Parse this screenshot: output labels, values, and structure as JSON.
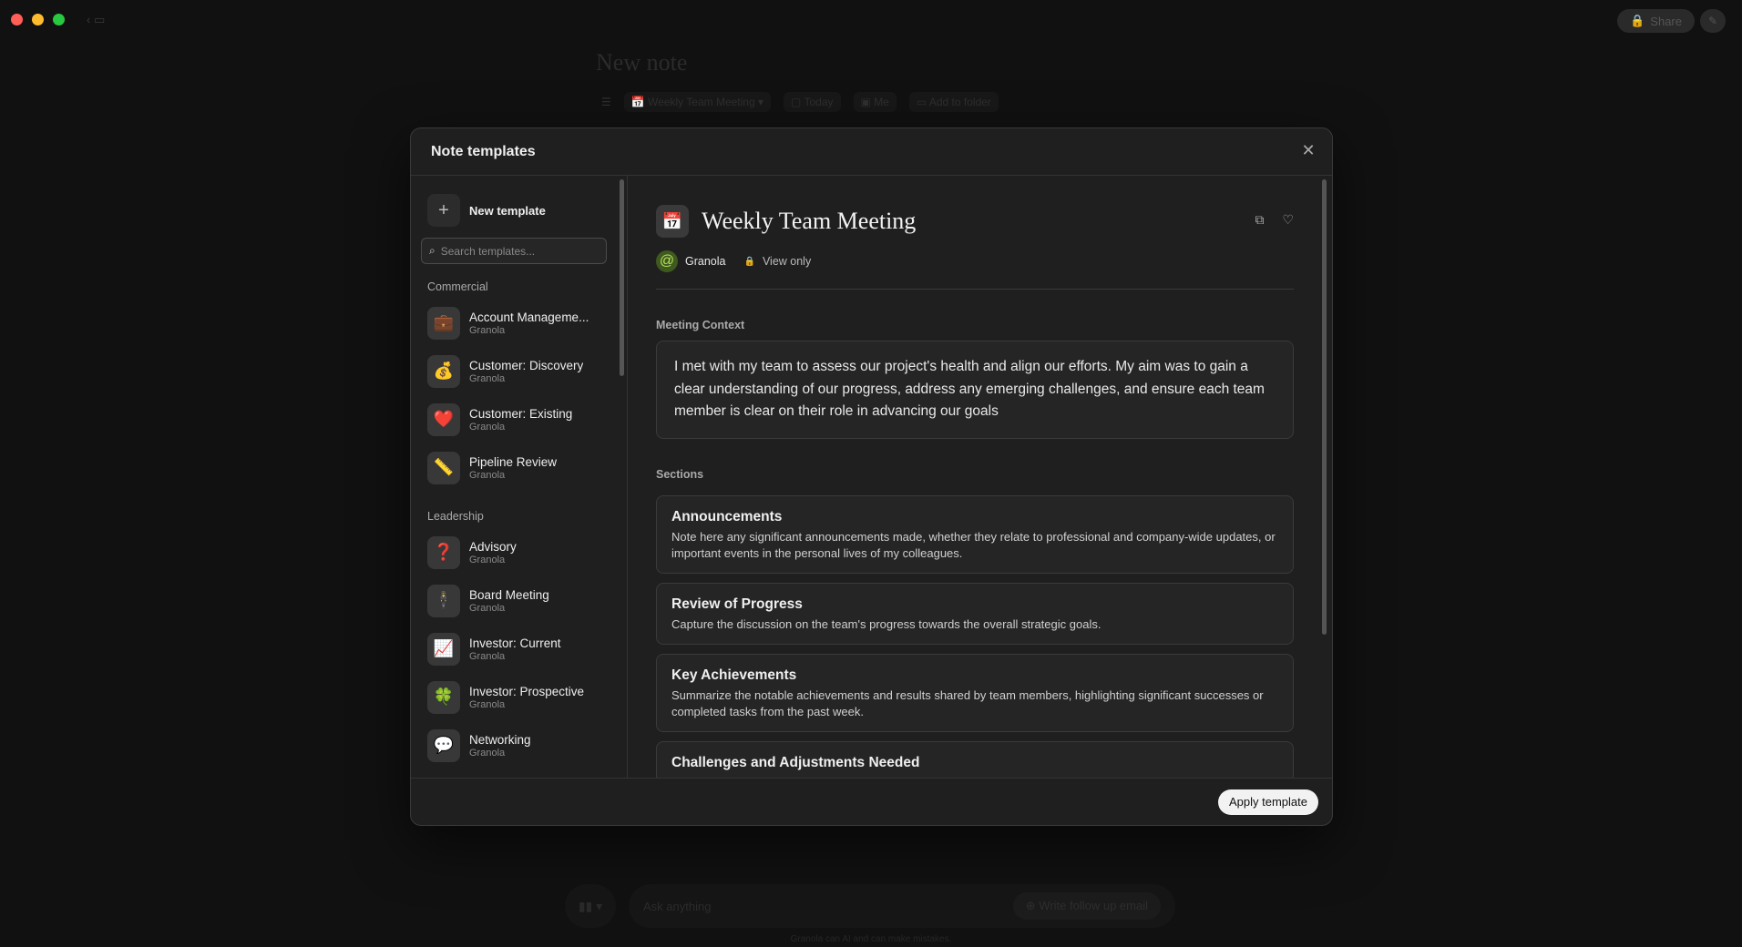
{
  "window": {
    "share_label": "Share"
  },
  "background_note": {
    "title": "New note",
    "template_chip": "Weekly Team Meeting",
    "date_chip": "Today",
    "people_chip": "Me",
    "folder_chip": "Add to folder",
    "ask_placeholder": "Ask anything",
    "followup_label": "Write follow up email",
    "footer_note": "Granola can AI and can make mistakes."
  },
  "modal": {
    "title": "Note templates",
    "apply_label": "Apply template"
  },
  "sidebar": {
    "new_template_label": "New template",
    "search_placeholder": "Search templates...",
    "groups": [
      {
        "label": "Commercial",
        "items": [
          {
            "icon": "💼",
            "name": "Account Manageme...",
            "source": "Granola"
          },
          {
            "icon": "💰",
            "name": "Customer: Discovery",
            "source": "Granola"
          },
          {
            "icon": "❤️",
            "name": "Customer: Existing",
            "source": "Granola"
          },
          {
            "icon": "📏",
            "name": "Pipeline Review",
            "source": "Granola"
          }
        ]
      },
      {
        "label": "Leadership",
        "items": [
          {
            "icon": "❓",
            "name": "Advisory",
            "source": "Granola"
          },
          {
            "icon": "🕴",
            "name": "Board Meeting",
            "source": "Granola"
          },
          {
            "icon": "📈",
            "name": "Investor: Current",
            "source": "Granola"
          },
          {
            "icon": "🍀",
            "name": "Investor: Prospective",
            "source": "Granola"
          },
          {
            "icon": "💬",
            "name": "Networking",
            "source": "Granola"
          }
        ]
      }
    ]
  },
  "template": {
    "icon": "📅",
    "title": "Weekly Team Meeting",
    "author": "Granola",
    "access": "View only",
    "context_label": "Meeting Context",
    "context_text": "I met with my team to assess our project's health and align our efforts. My aim was to gain a clear understanding of our progress, address any emerging challenges, and ensure each team member is clear on their role in advancing our goals",
    "sections_label": "Sections",
    "sections": [
      {
        "title": "Announcements",
        "desc": "Note here any significant announcements made, whether they relate to professional and company-wide updates, or important events in the personal lives of my colleagues."
      },
      {
        "title": "Review of Progress",
        "desc": "Capture the discussion on the team's progress towards the overall strategic goals."
      },
      {
        "title": "Key Achievements",
        "desc": "Summarize the notable achievements and results shared by team members, highlighting significant successes or completed tasks from the past week."
      },
      {
        "title": "Challenges and Adjustments Needed",
        "desc": ""
      }
    ]
  }
}
